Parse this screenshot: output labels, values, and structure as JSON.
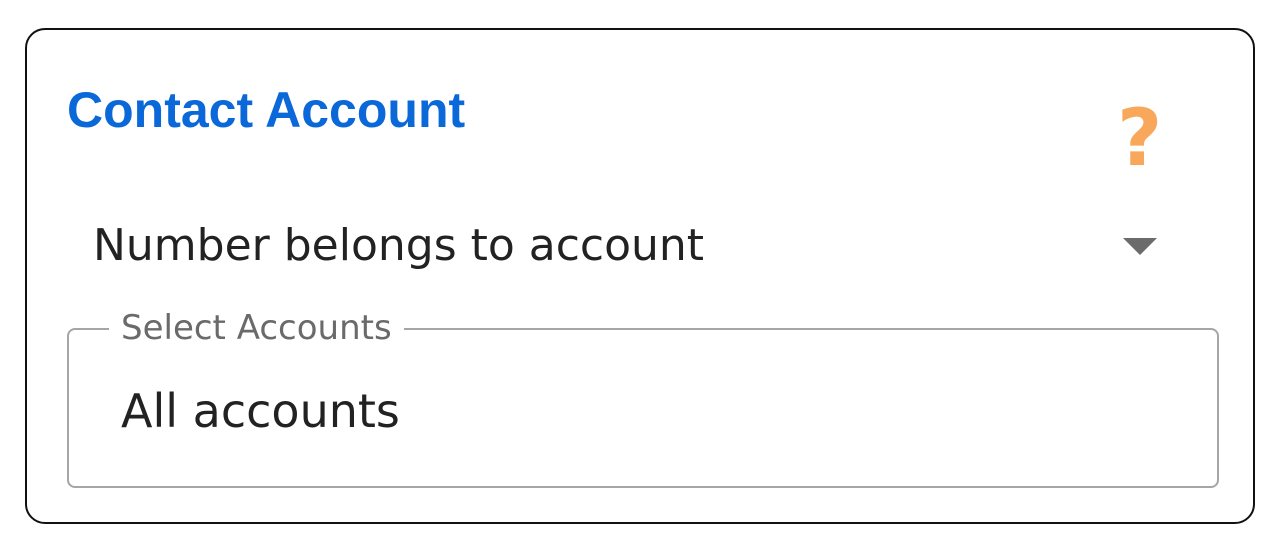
{
  "card": {
    "title": "Contact Account",
    "help_icon": "?",
    "condition_select": {
      "value": "Number belongs to account"
    },
    "accounts_field": {
      "label": "Select Accounts",
      "value": "All accounts"
    }
  },
  "colors": {
    "title": "#0b68d8",
    "help_icon": "#f9a85b",
    "border": "#111111",
    "field_border": "#a6a6a6"
  },
  "icons": {
    "help": "question-mark-icon",
    "dropdown": "caret-down-icon"
  }
}
